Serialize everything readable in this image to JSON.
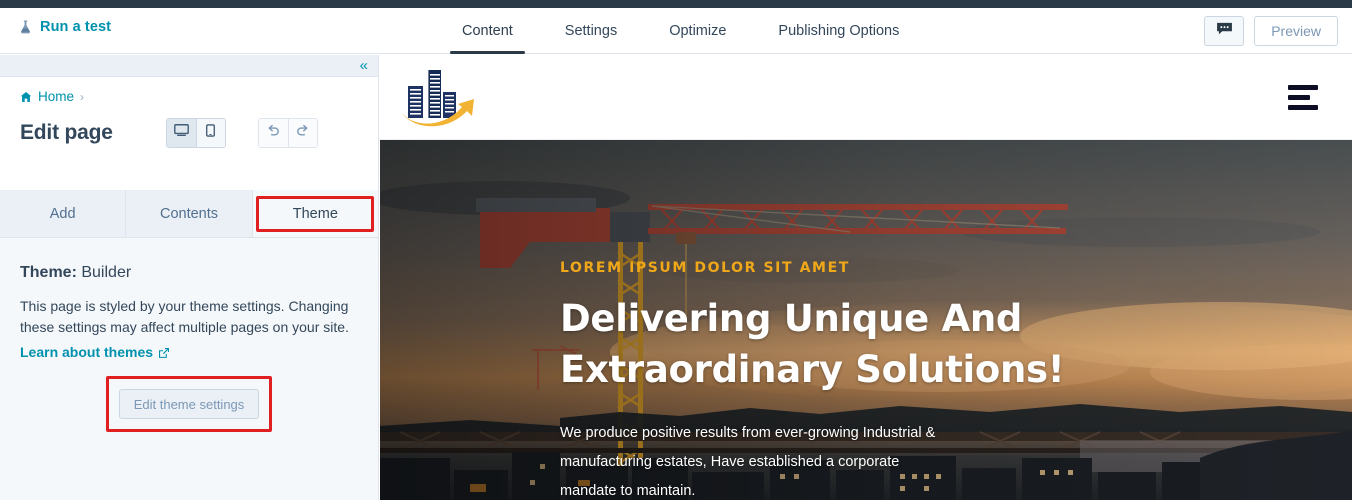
{
  "app": {
    "run_test_label": "Run a test",
    "tabs": [
      {
        "label": "Content",
        "active": true
      },
      {
        "label": "Settings",
        "active": false
      },
      {
        "label": "Optimize",
        "active": false
      },
      {
        "label": "Publishing Options",
        "active": false
      }
    ],
    "comment_icon": "comment-icon",
    "preview_label": "Preview"
  },
  "sidebar": {
    "collapse_icon": "chevron-double-left-icon",
    "breadcrumb": {
      "home_label": "Home",
      "home_icon": "home-icon",
      "separator": "›"
    },
    "page_title": "Edit page",
    "device_toggle": [
      {
        "name": "desktop-icon",
        "active": true
      },
      {
        "name": "mobile-icon",
        "active": false
      }
    ],
    "history": [
      {
        "name": "undo-icon"
      },
      {
        "name": "redo-icon"
      }
    ],
    "panel_tabs": [
      {
        "label": "Add",
        "active": false,
        "highlighted": false
      },
      {
        "label": "Contents",
        "active": false,
        "highlighted": false
      },
      {
        "label": "Theme",
        "active": true,
        "highlighted": true
      }
    ],
    "theme": {
      "label": "Theme:",
      "name": "Builder",
      "description": "This page is styled by your theme settings. Changing these settings may affect multiple pages on your site.",
      "learn_link": "Learn about themes",
      "learn_link_icon": "external-link-icon",
      "edit_button": "Edit theme settings",
      "edit_button_highlighted": true
    }
  },
  "preview": {
    "logo_alt": "building-logo",
    "menu_icon": "hamburger-menu-icon",
    "hero": {
      "eyebrow": "Lorem ipsum dolor sit amet",
      "heading": "Delivering Unique And Extraordinary Solutions!",
      "paragraph": "We produce positive results from ever-growing Industrial & manufacturing estates, Have established a corporate mandate to maintain."
    }
  },
  "colors": {
    "top_strip": "#2a3b47",
    "link_teal": "#0091ae",
    "text_dark": "#33475b",
    "sidebar_bg": "#f5f8fa",
    "tab_inactive_bg": "#eaf0f6",
    "border": "#dfe3eb",
    "annotation_red": "#e02020",
    "hero_accent": "#f0a818",
    "logo_navy": "#1f3264",
    "logo_gold": "#f2b233"
  }
}
